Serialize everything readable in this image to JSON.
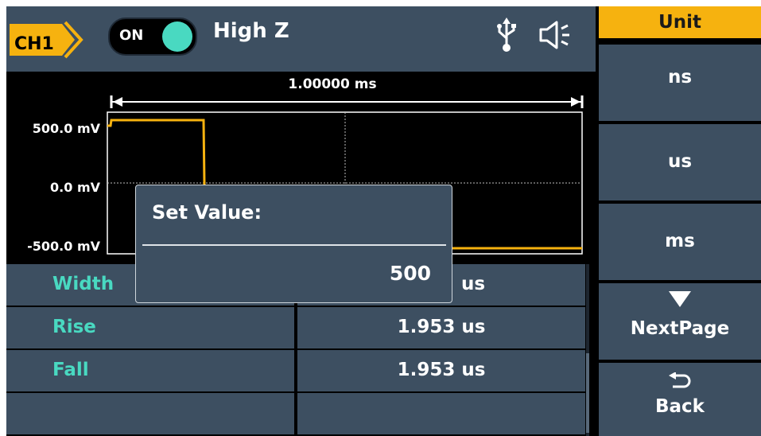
{
  "header": {
    "channel": "CH1",
    "output_toggle": "ON",
    "load": "High Z",
    "colors": {
      "accent": "#f6b20f",
      "toggle": "#49d9c1",
      "panel": "#3d4f61"
    }
  },
  "waveform": {
    "period_label": "1.00000 ms",
    "y_labels": [
      "500.0 mV",
      "0.0 mV",
      "-500.0 mV"
    ],
    "trace_color": "#f6b20f"
  },
  "params": [
    {
      "name": "Width",
      "value": "us"
    },
    {
      "name": "Rise",
      "value": "1.953 us"
    },
    {
      "name": "Fall",
      "value": "1.953 us"
    },
    {
      "name": "",
      "value": ""
    }
  ],
  "dialog": {
    "title": "Set Value:",
    "value": "500"
  },
  "menu": {
    "title": "Unit",
    "buttons": [
      "ns",
      "us",
      "ms"
    ],
    "next_page": "NextPage",
    "back": "Back"
  }
}
